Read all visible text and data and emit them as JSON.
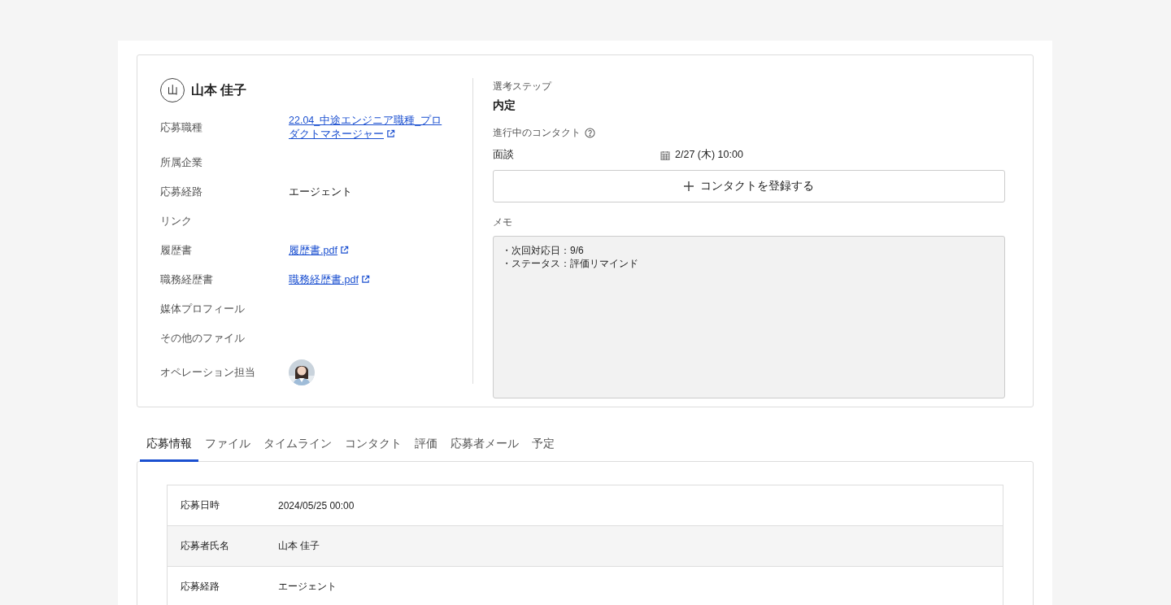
{
  "candidate": {
    "initial": "山",
    "name": "山本 佳子"
  },
  "details": [
    {
      "label": "応募職種",
      "kind": "link",
      "value": "22.04_中途エンジニア職種_プロダクトマネージャー"
    },
    {
      "label": "所属企業",
      "kind": "none"
    },
    {
      "label": "応募経路",
      "kind": "text",
      "value": "エージェント"
    },
    {
      "label": "リンク",
      "kind": "none"
    },
    {
      "label": "履歴書",
      "kind": "link",
      "value": "履歴書.pdf"
    },
    {
      "label": "職務経歴書",
      "kind": "link",
      "value": "職務経歴書.pdf"
    },
    {
      "label": "媒体プロフィール",
      "kind": "none"
    },
    {
      "label": "その他のファイル",
      "kind": "none"
    },
    {
      "label": "オペレーション担当",
      "kind": "picture"
    }
  ],
  "step": {
    "label": "選考ステップ",
    "value": "内定"
  },
  "contacts": {
    "label": "進行中のコンタクト",
    "items": [
      {
        "type": "面談",
        "datetime": "2/27 (木) 10:00"
      }
    ],
    "add_button": "コンタクトを登録する"
  },
  "memo": {
    "label": "メモ",
    "value": "・次回対応日：9/6\n・ステータス：評価リマインド"
  },
  "tabs": [
    {
      "label": "応募情報",
      "selected": true
    },
    {
      "label": "ファイル",
      "selected": false
    },
    {
      "label": "タイムライン",
      "selected": false
    },
    {
      "label": "コンタクト",
      "selected": false
    },
    {
      "label": "評価",
      "selected": false
    },
    {
      "label": "応募者メール",
      "selected": false
    },
    {
      "label": "予定",
      "selected": false
    }
  ],
  "table": {
    "rows": [
      {
        "label": "応募日時",
        "value": "2024/05/25 00:00"
      },
      {
        "label": "応募者氏名",
        "value": "山本 佳子"
      },
      {
        "label": "応募経路",
        "value": "エージェント"
      }
    ]
  }
}
